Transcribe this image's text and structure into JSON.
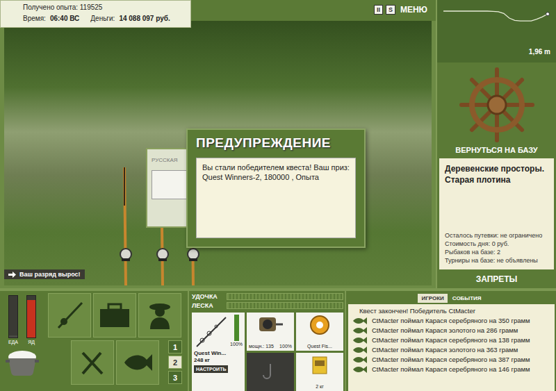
{
  "hud": {
    "experience": "Получено опыта: 119525",
    "time_label": "Время:",
    "time": "06:40 ВС",
    "money_label": "Деньги:",
    "money": "14 088 097 руб."
  },
  "top_buttons": [
    {
      "label": "II",
      "kind": "box"
    },
    {
      "label": "S",
      "kind": "box"
    },
    {
      "label": "МЕНЮ",
      "kind": "text"
    }
  ],
  "depth": {
    "reading": "1,96 m",
    "profile": [
      0.3,
      0.3,
      0.3,
      0.3,
      0.3,
      0.3,
      0.3,
      0.3,
      0.3,
      0.32,
      0.35,
      0.5,
      0.9,
      1.1,
      1.15,
      1.15,
      1.15,
      1.0,
      0.8,
      0.55
    ]
  },
  "base": {
    "button": "ВЕРНУТЬСЯ НА БАЗУ",
    "title": "Деревенские просторы. Старая плотина",
    "facts": [
      "Осталось путевки: не ограничено",
      "Стоимость дня: 0 руб.",
      "Рыбаков на базе: 2",
      "Турниры на базе: не объявлены"
    ],
    "bans": "ЗАПРЕТЫ"
  },
  "back_panel": {
    "title": "РУССКАЯ"
  },
  "dialog": {
    "title": "ПРЕДУПРЕЖДЕНИЕ",
    "message": "Вы стали победителем квеста! Ваш приз: Quest Winners-2, 180000 , Опыта"
  },
  "badge": {
    "text": "Ваш разряд вырос!"
  },
  "needs": [
    {
      "label": "ЕДА",
      "level": 0.05,
      "color": "#4a4a44"
    },
    {
      "label": "ЯД",
      "level": 0.9,
      "color": "#c8321e"
    }
  ],
  "pages": [
    {
      "label": "1",
      "selected": false
    },
    {
      "label": "2",
      "selected": true
    },
    {
      "label": "3",
      "selected": false
    }
  ],
  "gauges": [
    {
      "label": "УДОЧКА",
      "level": 0
    },
    {
      "label": "ЛЕСКА",
      "level": 0
    }
  ],
  "tackle": {
    "rod": {
      "name": "Quest Win...",
      "weight": "248 кг",
      "condition": "100%",
      "level": 1.0,
      "button": "НАСТРОИТЬ"
    },
    "reel": {
      "power": "мощн.: 135",
      "condition": "100%"
    },
    "line": {
      "name": "Quest Fis..."
    },
    "bait": {
      "amount": "2 кг"
    }
  },
  "chat": {
    "tabs": [
      {
        "label": "ИГРОКИ",
        "selected": true
      },
      {
        "label": "СОБЫТИЯ",
        "selected": false
      }
    ],
    "notice": "Квест закончен! Победитель CtMacter",
    "messages": [
      "CtMacter поймал Карася серебряного на 350 грамм",
      "CtMacter поймал Карася золотого на 286 грамм",
      "CtMacter поймал Карася серебряного на 138 грамм",
      "CtMacter поймал Карася золотого на 363 грамм",
      "CtMacter поймал Карася серебряного на 387 грамм",
      "CtMacter поймал Карася серебряного на 146 грамм"
    ]
  }
}
